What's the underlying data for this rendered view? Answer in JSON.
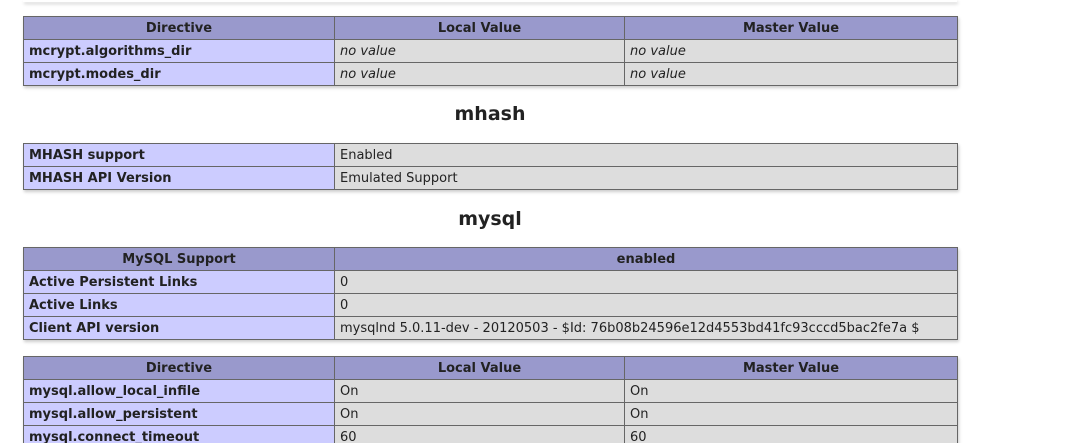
{
  "mcrypt_directives": {
    "headers": [
      "Directive",
      "Local Value",
      "Master Value"
    ],
    "rows": [
      {
        "directive": "mcrypt.algorithms_dir",
        "local": "no value",
        "master": "no value"
      },
      {
        "directive": "mcrypt.modes_dir",
        "local": "no value",
        "master": "no value"
      }
    ]
  },
  "mhash": {
    "title": "mhash",
    "rows": [
      {
        "key": "MHASH support",
        "value": "Enabled"
      },
      {
        "key": "MHASH API Version",
        "value": "Emulated Support"
      }
    ]
  },
  "mysql": {
    "title": "mysql",
    "info_header": {
      "key": "MySQL Support",
      "value": "enabled"
    },
    "info_rows": [
      {
        "key": "Active Persistent Links",
        "value": "0"
      },
      {
        "key": "Active Links",
        "value": "0"
      },
      {
        "key": "Client API version",
        "value": "mysqlnd 5.0.11-dev - 20120503 - $Id: 76b08b24596e12d4553bd41fc93cccd5bac2fe7a $"
      }
    ],
    "directive_headers": [
      "Directive",
      "Local Value",
      "Master Value"
    ],
    "directives": [
      {
        "directive": "mysql.allow_local_infile",
        "local": "On",
        "master": "On"
      },
      {
        "directive": "mysql.allow_persistent",
        "local": "On",
        "master": "On"
      },
      {
        "directive": "mysql.connect_timeout",
        "local": "60",
        "master": "60"
      }
    ]
  },
  "colors": {
    "header_bg": "#9999cc",
    "key_bg": "#ccccff",
    "value_bg": "#dddddd",
    "no_value_text": "#999999"
  }
}
